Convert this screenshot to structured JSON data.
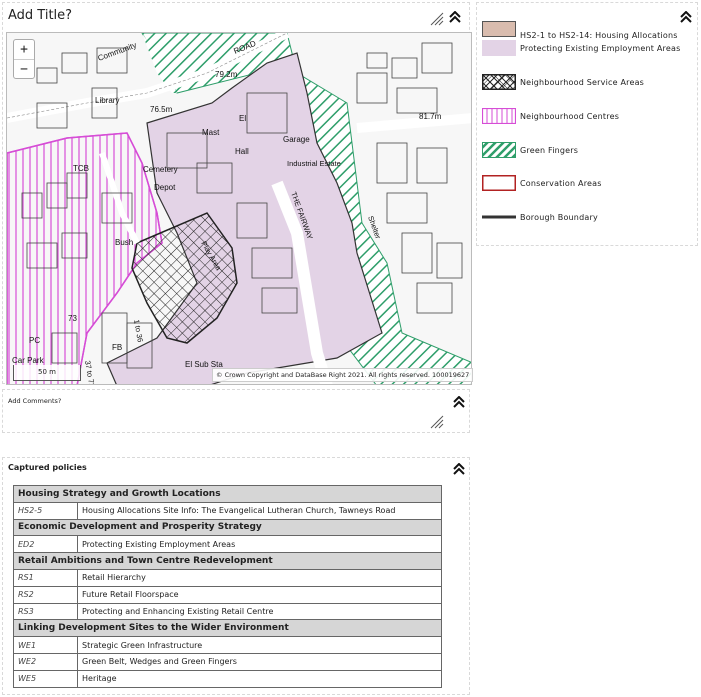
{
  "map_panel": {
    "title": "Add Title?",
    "zoom_in": "+",
    "zoom_out": "−",
    "scale_text": "50 m",
    "copyright": "© Crown Copyright and DataBase Right 2021. All rights reserved. 100019627",
    "labels": [
      {
        "text": "Community",
        "kind": "place"
      },
      {
        "text": "Library",
        "kind": "place"
      },
      {
        "text": "79.2m",
        "kind": "spot"
      },
      {
        "text": "76.5m",
        "kind": "spot"
      },
      {
        "text": "81.7m",
        "kind": "spot"
      },
      {
        "text": "ROAD",
        "kind": "road"
      },
      {
        "text": "Mast",
        "kind": "place"
      },
      {
        "text": "Hall",
        "kind": "place"
      },
      {
        "text": "El",
        "kind": "place"
      },
      {
        "text": "Garage",
        "kind": "place"
      },
      {
        "text": "Industrial Estate",
        "kind": "place"
      },
      {
        "text": "THE FAIRWAY",
        "kind": "road"
      },
      {
        "text": "Shelter",
        "kind": "place"
      },
      {
        "text": "Cemetery",
        "kind": "place"
      },
      {
        "text": "Depot",
        "kind": "place"
      },
      {
        "text": "TCB",
        "kind": "place"
      },
      {
        "text": "Bush",
        "kind": "place"
      },
      {
        "text": "Play Area",
        "kind": "place"
      },
      {
        "text": "73",
        "kind": "number"
      },
      {
        "text": "1 to 36",
        "kind": "number"
      },
      {
        "text": "FB",
        "kind": "place"
      },
      {
        "text": "PC",
        "kind": "place"
      },
      {
        "text": "Car Park",
        "kind": "place"
      },
      {
        "text": "El Sub Sta",
        "kind": "place"
      },
      {
        "text": "37 to 72",
        "kind": "number"
      }
    ]
  },
  "legend": {
    "items": [
      {
        "label": "HS2-1 to HS2-14: Housing Allocations",
        "swatch": "housing",
        "color": "#d9bcae"
      },
      {
        "label": "Protecting Existing Employment Areas",
        "swatch": "employment",
        "color": "#e3d3e6"
      },
      {
        "label": "Neighbourhood Service Areas",
        "swatch": "service",
        "color": "#222222"
      },
      {
        "label": "Neighbourhood Centres",
        "swatch": "centres",
        "color": "#d64dd6"
      },
      {
        "label": "Green Fingers",
        "swatch": "green",
        "color": "#2e9e6a"
      },
      {
        "label": "Conservation Areas",
        "swatch": "conservation",
        "color": "#b22222"
      },
      {
        "label": "Borough Boundary",
        "swatch": "boundary",
        "color": "#333333"
      }
    ]
  },
  "comments_panel": {
    "title": "Add Comments?"
  },
  "policies_panel": {
    "title": "Captured policies",
    "groups": [
      {
        "heading": "Housing Strategy and Growth Locations",
        "rows": [
          {
            "code": "HS2-5",
            "text": "Housing Allocations Site Info: The Evangelical Lutheran Church, Tawneys Road"
          }
        ]
      },
      {
        "heading": "Economic Development and Prosperity Strategy",
        "rows": [
          {
            "code": "ED2",
            "text": "Protecting Existing Employment Areas"
          }
        ]
      },
      {
        "heading": "Retail Ambitions and Town Centre Redevelopment",
        "rows": [
          {
            "code": "RS1",
            "text": "Retail Hierarchy"
          },
          {
            "code": "RS2",
            "text": "Future Retail Floorspace"
          },
          {
            "code": "RS3",
            "text": "Protecting and Enhancing Existing Retail Centre"
          }
        ]
      },
      {
        "heading": "Linking Development Sites to the Wider Environment",
        "rows": [
          {
            "code": "WE1",
            "text": "Strategic Green Infrastructure"
          },
          {
            "code": "WE2",
            "text": "Green Belt, Wedges and Green Fingers"
          },
          {
            "code": "WE5",
            "text": "Heritage"
          }
        ]
      }
    ]
  }
}
